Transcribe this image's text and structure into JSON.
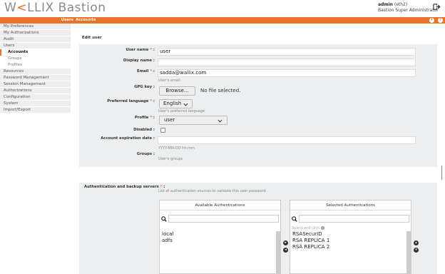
{
  "header": {
    "logo_main": "W",
    "logo_accent": "<",
    "logo_rest": "LLIX Bastion",
    "user": "admin",
    "user_suffix": "(eth2)",
    "role": "Bastion Super Administrator",
    "breadcrumb_section": "Users",
    "breadcrumb_page": "Accounts",
    "info_icon": "i",
    "help_icon": "?"
  },
  "sidebar": {
    "items": [
      {
        "label": "My Preferences"
      },
      {
        "label": "My Authorizations"
      },
      {
        "label": "Audit"
      },
      {
        "label": "Users"
      },
      {
        "label": "Accounts"
      },
      {
        "label": "Groups"
      },
      {
        "label": "Profiles"
      },
      {
        "label": "Resources"
      },
      {
        "label": "Password Management"
      },
      {
        "label": "Session Management"
      },
      {
        "label": "Authorizations"
      },
      {
        "label": "Configuration"
      },
      {
        "label": "System"
      },
      {
        "label": "Import/Export"
      }
    ]
  },
  "form": {
    "title": "Edit user",
    "username_label": "User name",
    "username_value": "user",
    "display_label": "Display name :",
    "display_value": "",
    "email_label": "Email",
    "email_value": "sadda@wallix.com",
    "email_hint": "User's email",
    "gpg_label": "GPG key :",
    "browse_label": "Browse...",
    "no_file": "No file selected.",
    "lang_label": "Preferred language",
    "lang_value": "English",
    "lang_hint": "User's preferred language",
    "profile_label": "Profile",
    "profile_value": "user",
    "disabled_label": "Disabled :",
    "expiration_label": "Account expiration date :",
    "expiration_hint": "YYYY-MM-DD hh:mm",
    "groups_label": "Groups :",
    "groups_hint": "User's groups",
    "required_mark": "*",
    "colon": ":"
  },
  "auth": {
    "label": "Authentication and backup servers",
    "hint": "List of authentication sources to validate this user password",
    "available_title": "Available Authentications",
    "selected_title": "Selected Authentications",
    "select_hint": "Select and click",
    "available": [
      "local",
      "adfs"
    ],
    "selected": [
      "RSASecurID",
      "RSA REPLICA 1",
      "RSA REPLICA 2"
    ]
  }
}
